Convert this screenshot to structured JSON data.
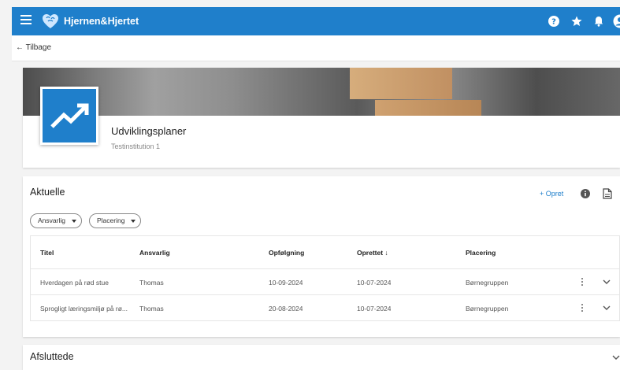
{
  "app": {
    "title": "Hjernen&Hjertet"
  },
  "nav": {
    "back_label": "Tilbage"
  },
  "header": {
    "title": "Udviklingsplaner",
    "subtitle": "Testinstitution 1"
  },
  "current": {
    "title": "Aktuelle",
    "create_label": "+ Opret",
    "filters": [
      "Ansvarlig",
      "Placering"
    ],
    "columns": [
      "Titel",
      "Ansvarlig",
      "Opfølgning",
      "Oprettet ↓",
      "Placering"
    ],
    "rows": [
      {
        "titel": "Hverdagen på rød stue",
        "ansvarlig": "Thomas",
        "opfolgning": "10-09-2024",
        "oprettet": "10-07-2024",
        "placering": "Børnegruppen"
      },
      {
        "titel": "Sprogligt læringsmiljø på rø...",
        "ansvarlig": "Thomas",
        "opfolgning": "20-08-2024",
        "oprettet": "10-07-2024",
        "placering": "Børnegruppen"
      }
    ]
  },
  "finished": {
    "title": "Afsluttede"
  },
  "icons": {
    "menu": "hamburger-menu-icon",
    "logo": "heart-brain-logo",
    "help": "help-icon",
    "favorite": "star-icon",
    "notifications": "bell-icon",
    "account": "account-icon",
    "back": "arrow-left-icon",
    "app": "trending-up-icon",
    "info": "info-icon",
    "document": "document-icon",
    "row_menu": "more-vert-icon",
    "expand": "chevron-down-icon"
  },
  "colors": {
    "primary": "#1f7fcb",
    "background": "#f3f3f3"
  }
}
